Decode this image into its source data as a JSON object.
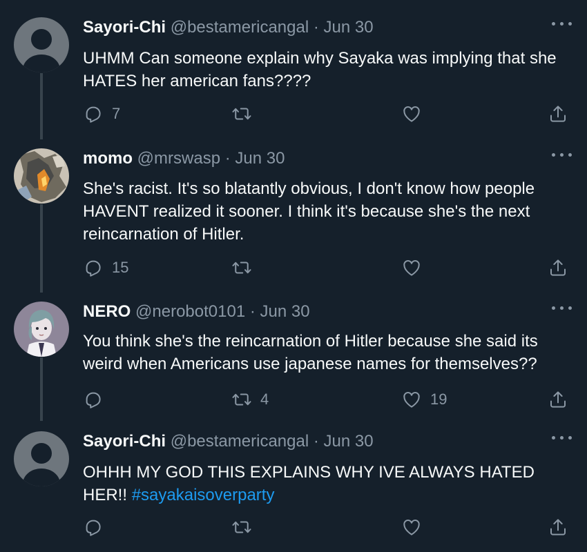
{
  "tweets": [
    {
      "name": "Sayori-Chi",
      "handle": "@bestamericangal",
      "separator": "·",
      "date": "Jun 30",
      "text": "UHMM Can someone explain why Sayaka was implying that she HATES her american fans????",
      "hashtag": "",
      "reply_count": "7",
      "retweet_count": "",
      "like_count": ""
    },
    {
      "name": "momo",
      "handle": "@mrswasp",
      "separator": "·",
      "date": "Jun 30",
      "text": "She's racist. It's so blatantly obvious, I don't know how people HAVENT realized it sooner. I think it's because she's the next reincarnation of Hitler.",
      "hashtag": "",
      "reply_count": "15",
      "retweet_count": "",
      "like_count": ""
    },
    {
      "name": "NERO",
      "handle": "@nerobot0101",
      "separator": "·",
      "date": "Jun 30",
      "text": "You think she's the reincarnation of Hitler because she said its weird when Americans use japanese names for themselves??",
      "hashtag": "",
      "reply_count": "",
      "retweet_count": "4",
      "like_count": "19"
    },
    {
      "name": "Sayori-Chi",
      "handle": "@bestamericangal",
      "separator": "·",
      "date": "Jun 30",
      "text": "OHHH MY GOD THIS EXPLAINS WHY IVE ALWAYS HATED HER!! ",
      "hashtag": "#sayakaisoverparty",
      "reply_count": "",
      "retweet_count": "",
      "like_count": ""
    }
  ],
  "icons": {
    "reply": "reply-icon",
    "retweet": "retweet-icon",
    "like": "heart-icon",
    "share": "share-icon",
    "more": "more-icon"
  },
  "colors": {
    "background": "#15202b",
    "text": "#f7f9f9",
    "secondary": "#8b98a5",
    "link": "#1d9bf0",
    "thread_line": "#38444d"
  }
}
